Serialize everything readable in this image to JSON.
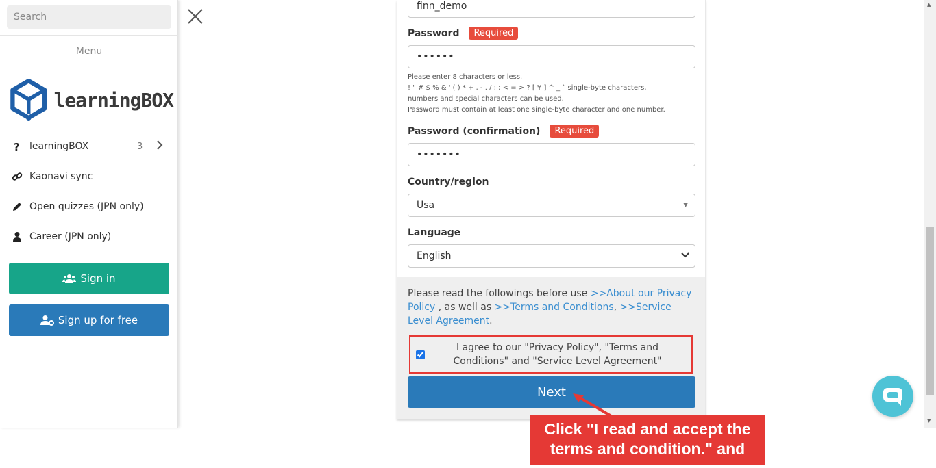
{
  "sidebar": {
    "search_placeholder": "Search",
    "menu_label": "Menu",
    "logo_text": "learningBOX",
    "items": [
      {
        "label": "learningBOX",
        "count": "3",
        "icon": "question-icon"
      },
      {
        "label": "Kaonavi sync",
        "icon": "link-icon"
      },
      {
        "label": "Open quizzes (JPN only)",
        "icon": "pencil-icon"
      },
      {
        "label": "Career (JPN only)",
        "icon": "user-icon"
      }
    ],
    "signin_label": "Sign in",
    "signup_label": "Sign up for free",
    "colors": {
      "signin": "#17a589",
      "signup": "#2a7ab9"
    }
  },
  "form": {
    "username_value": "finn_demo",
    "password_label": "Password",
    "required_badge": "Required",
    "password_value": "••••••",
    "hint_lines": [
      "Please enter 8 characters or less.",
      "! \" # $ % & ' ( ) * + , - . / : ; < = > ? [ ¥ ] ^ _ ` single-byte characters,",
      "numbers and special characters can be used.",
      "Password must contain at least one single-byte character and one number."
    ],
    "password_confirm_label": "Password (confirmation)",
    "password_confirm_value": "•••••••",
    "country_label": "Country/region",
    "country_value": "Usa",
    "language_label": "Language",
    "language_value": "English",
    "agree_intro": "Please read the followings before use ",
    "link_privacy": ">>About our Privacy Policy",
    "agree_as_well": " , as well as ",
    "link_terms": ">>Terms and Conditions",
    "comma": ", ",
    "link_sla": ">>Service Level Agreement",
    "period": ".",
    "agree_checkbox_label": "I agree to our \"Privacy Policy\", \"Terms and Conditions\" and \"Service Level Agreement\"",
    "agree_checked": true,
    "next_label": "Next"
  },
  "annotation": {
    "text": "Click \"I read and accept the terms and condition.\" and",
    "color": "#e53935"
  },
  "chat": {
    "icon": "chat-icon",
    "color": "#4ec3d6"
  }
}
